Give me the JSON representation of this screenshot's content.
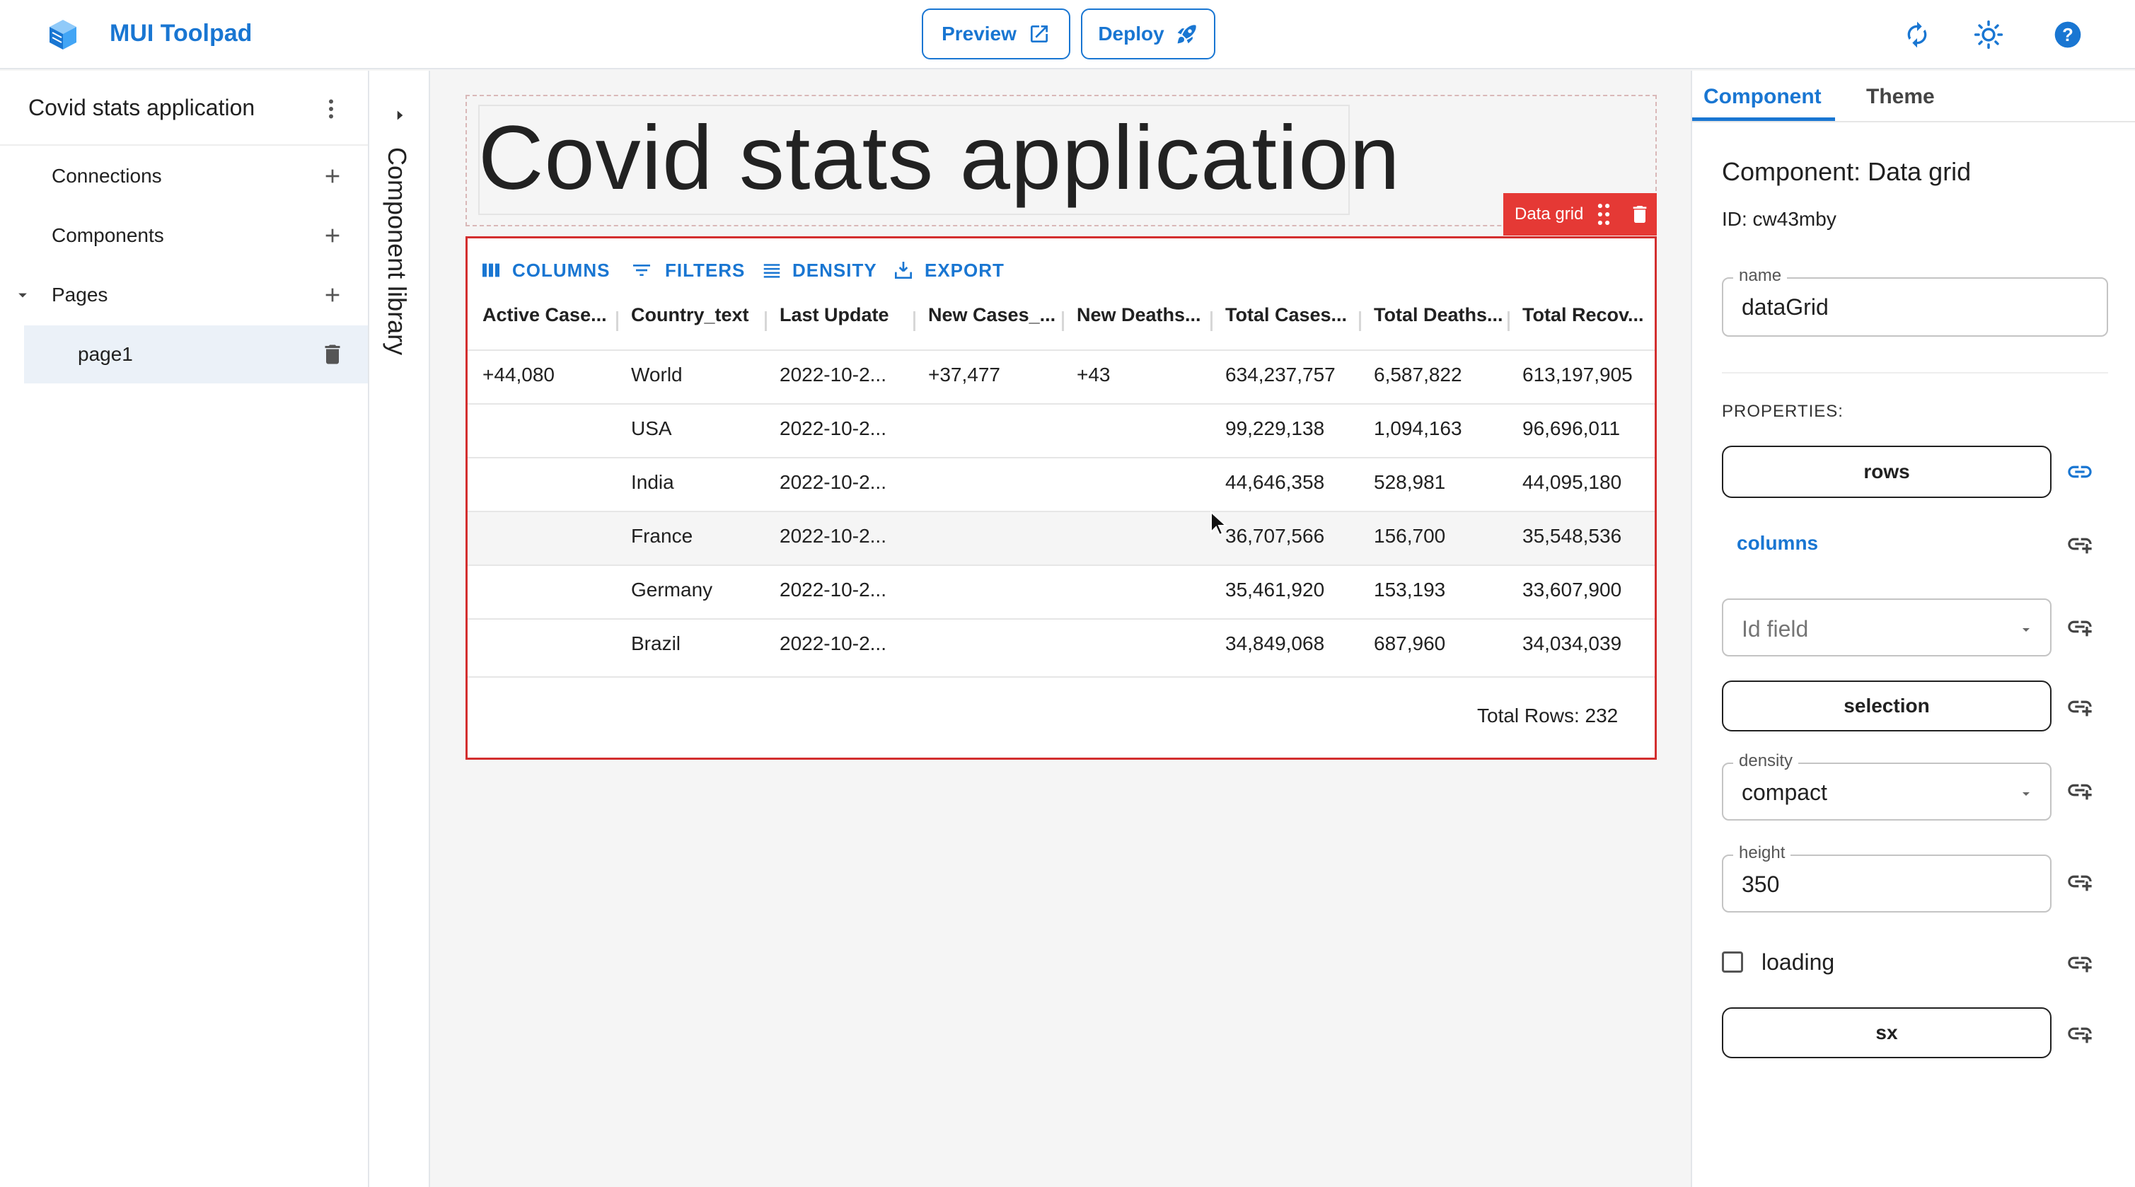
{
  "header": {
    "brand": "MUI Toolpad",
    "preview_label": "Preview",
    "deploy_label": "Deploy"
  },
  "sidebar": {
    "app_name": "Covid stats application",
    "items": [
      {
        "label": "Connections"
      },
      {
        "label": "Components"
      },
      {
        "label": "Pages"
      }
    ],
    "pages": [
      {
        "label": "page1"
      }
    ]
  },
  "library": {
    "label": "Component library"
  },
  "canvas": {
    "title_text": "Covid stats application",
    "grid_tag": "Data grid",
    "toolbar": {
      "columns": "COLUMNS",
      "filters": "FILTERS",
      "density": "DENSITY",
      "export": "EXPORT"
    },
    "headers": [
      "Active Case...",
      "Country_text",
      "Last Update",
      "New Cases_...",
      "New Deaths...",
      "Total Cases...",
      "Total Deaths...",
      "Total Recov..."
    ],
    "rows": [
      [
        "+44,080",
        "World",
        "2022-10-2...",
        "+37,477",
        "+43",
        "634,237,757",
        "6,587,822",
        "613,197,905"
      ],
      [
        "",
        "USA",
        "2022-10-2...",
        "",
        "",
        "99,229,138",
        "1,094,163",
        "96,696,011"
      ],
      [
        "",
        "India",
        "2022-10-2...",
        "",
        "",
        "44,646,358",
        "528,981",
        "44,095,180"
      ],
      [
        "",
        "France",
        "2022-10-2...",
        "",
        "",
        "36,707,566",
        "156,700",
        "35,548,536"
      ],
      [
        "",
        "Germany",
        "2022-10-2...",
        "",
        "",
        "35,461,920",
        "153,193",
        "33,607,900"
      ],
      [
        "",
        "Brazil",
        "2022-10-2...",
        "",
        "",
        "34,849,068",
        "687,960",
        "34,034,039"
      ]
    ],
    "total_rows": "Total Rows: 232"
  },
  "panel": {
    "tabs": {
      "component": "Component",
      "theme": "Theme"
    },
    "title": "Component: Data grid",
    "id_text": "ID: cw43mby",
    "name_label": "name",
    "name_value": "dataGrid",
    "properties_label": "PROPERTIES:",
    "rows_label": "rows",
    "columns_label": "columns",
    "id_field_placeholder": "Id field",
    "selection_label": "selection",
    "density_label": "density",
    "density_value": "compact",
    "height_label": "height",
    "height_value": "350",
    "loading_label": "loading",
    "sx_label": "sx"
  },
  "colors": {
    "accent": "#1976d2",
    "danger": "#e53935"
  }
}
